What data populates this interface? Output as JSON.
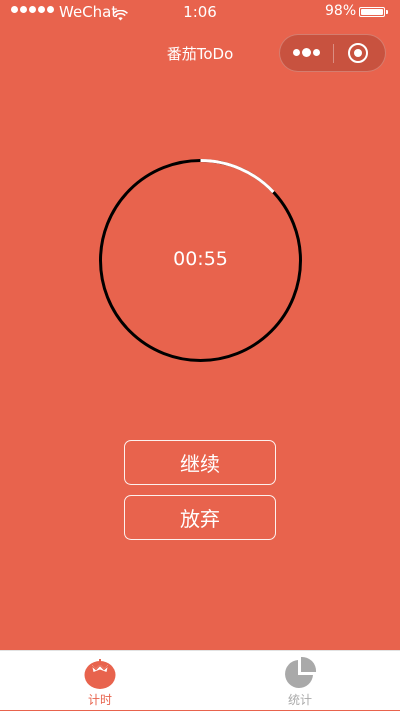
{
  "status_bar": {
    "carrier": "WeChat",
    "time": "1:06",
    "battery_percent": "98%",
    "battery_level": 0.98
  },
  "nav": {
    "title": "番茄ToDo"
  },
  "timer": {
    "display": "00:55",
    "elapsed_fraction": 0.13,
    "ring_color": "#000000",
    "elapsed_color": "#ffffff"
  },
  "actions": {
    "resume_label": "继续",
    "abandon_label": "放弃"
  },
  "tab_bar": {
    "tabs": [
      {
        "label": "计时",
        "icon": "tomato-icon",
        "active": true
      },
      {
        "label": "统计",
        "icon": "pie-chart-icon",
        "active": false
      }
    ]
  },
  "colors": {
    "background": "#e8634d",
    "tab_active": "#e8634d",
    "tab_inactive": "#a9a9a9"
  }
}
